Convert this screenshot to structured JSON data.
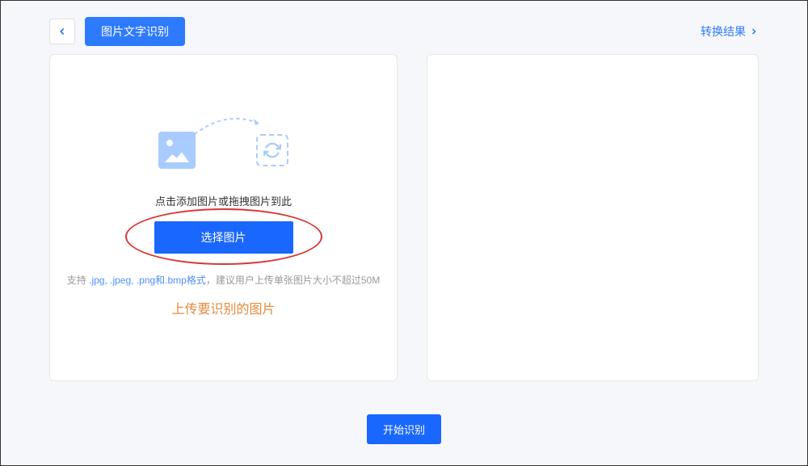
{
  "header": {
    "title": "图片文字识别",
    "result_link": "转换结果"
  },
  "upload": {
    "instruction": "点击添加图片或拖拽图片到此",
    "select_button": "选择图片",
    "format_hint_prefix": "支持 ",
    "format_hint_formats": ".jpg, .jpeg, .png和.bmp格式",
    "format_hint_suffix": "，建议用户上传单张图片大小不超过50M",
    "annotation": "上传要识别的图片"
  },
  "footer": {
    "start_button": "开始识别"
  }
}
